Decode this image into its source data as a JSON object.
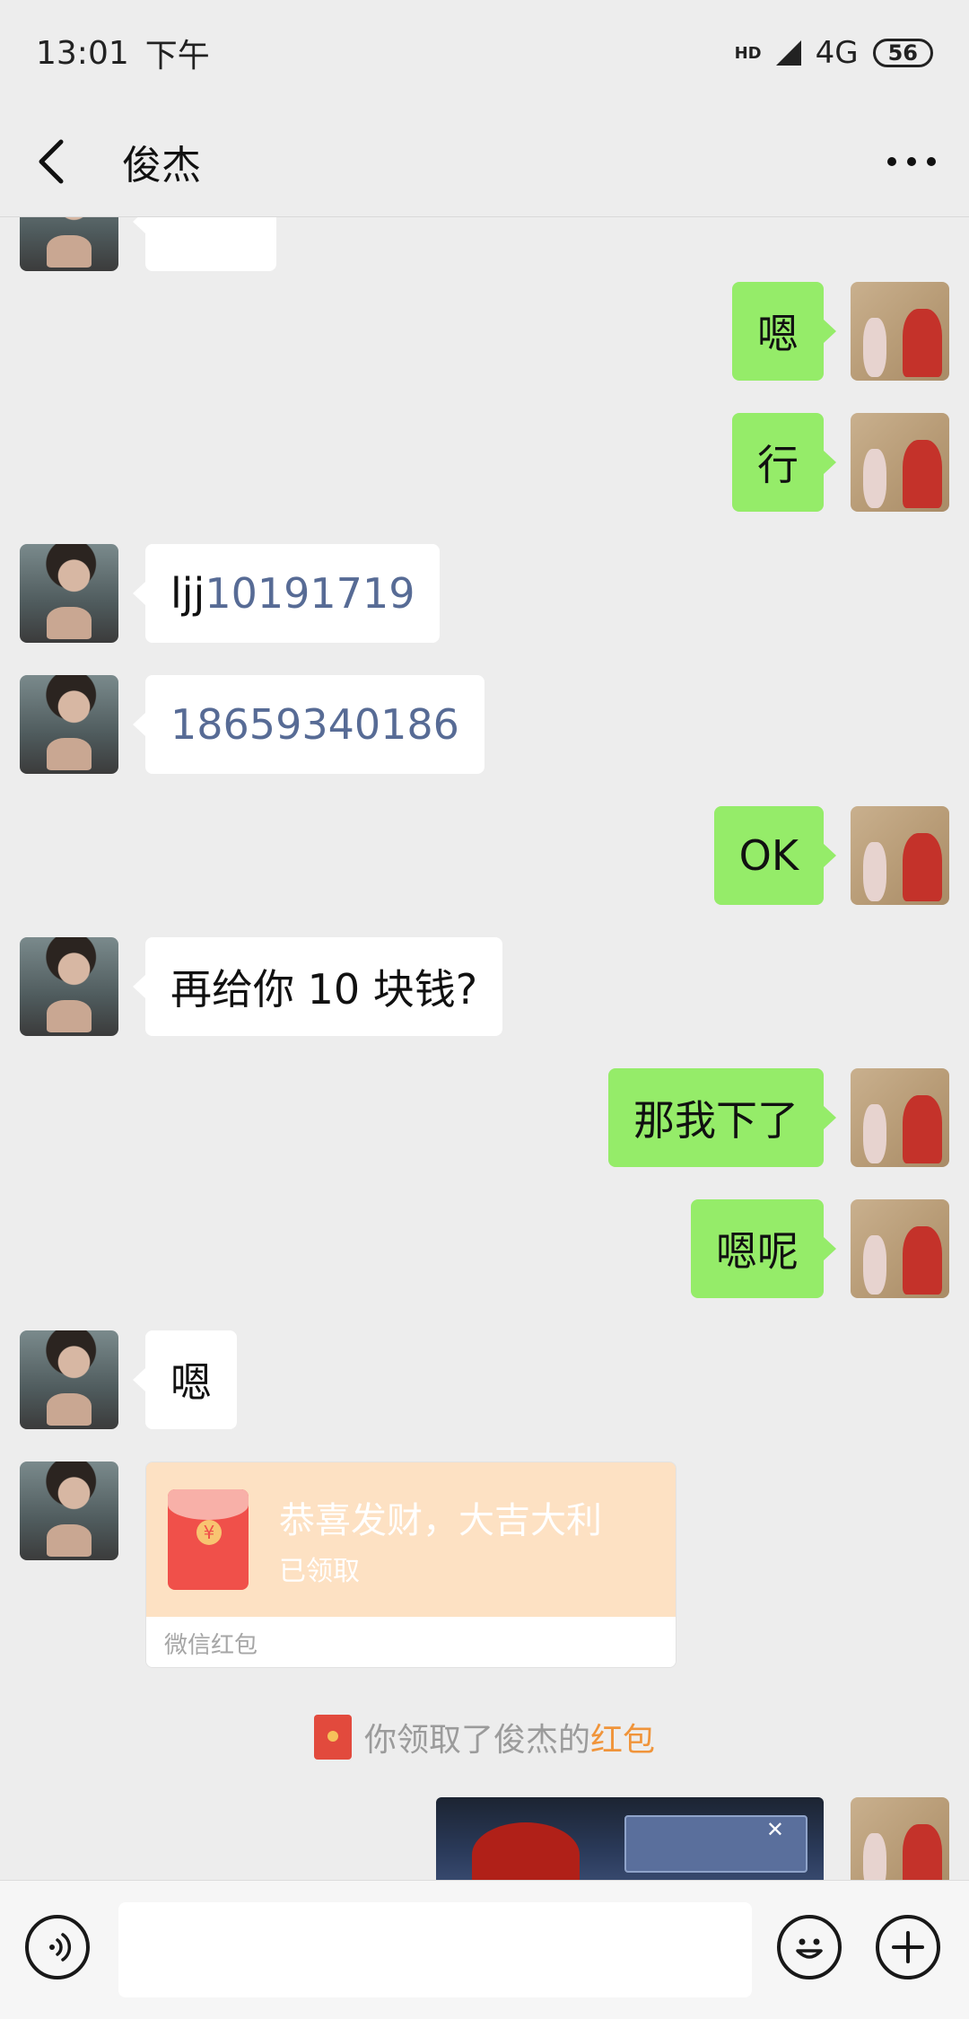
{
  "status_bar": {
    "time": "13:01",
    "period": "下午",
    "network": "4G",
    "signal_label": "HD",
    "battery": "56"
  },
  "header": {
    "title": "俊杰"
  },
  "messages": [
    {
      "side": "out",
      "text": "嗯"
    },
    {
      "side": "out",
      "text": "行"
    },
    {
      "side": "in",
      "text_prefix": "ljj",
      "text_link": "10191719"
    },
    {
      "side": "in",
      "text_link": "18659340186"
    },
    {
      "side": "out",
      "text": "OK"
    },
    {
      "side": "in",
      "text": "再给你 10 块钱?"
    },
    {
      "side": "out",
      "text": "那我下了"
    },
    {
      "side": "out",
      "text": "嗯呢"
    },
    {
      "side": "in",
      "text": "嗯"
    }
  ],
  "red_packet": {
    "title": "恭喜发财，大吉大利",
    "status": "已领取",
    "footer": "微信红包",
    "coin_symbol": "¥"
  },
  "system_message": {
    "prefix": "你领取了俊杰的",
    "highlight": "红包"
  },
  "game_shot": {
    "close_symbol": "✕"
  },
  "input": {
    "placeholder": ""
  },
  "colors": {
    "background": "#ededed",
    "outgoing_bubble": "#95ec69",
    "incoming_bubble": "#ffffff",
    "link": "#576b95",
    "red_packet_bg": "#fde1c3",
    "highlight": "#f0943a"
  },
  "icons": {
    "back": "chevron-left-icon",
    "more": "more-dots-icon",
    "voice": "voice-icon",
    "emoji": "emoji-icon",
    "plus": "plus-icon",
    "red_packet": "red-packet-icon"
  }
}
